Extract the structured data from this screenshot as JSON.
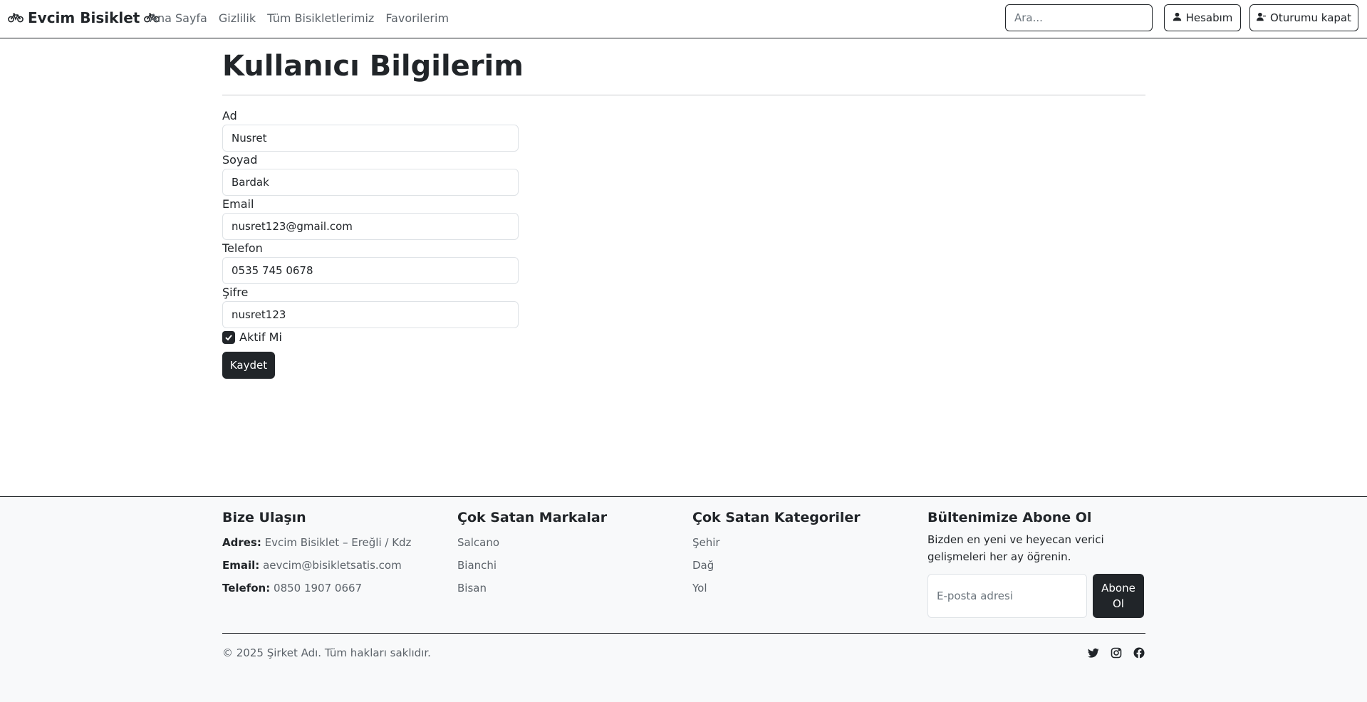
{
  "navbar": {
    "brand": "Evcim Bisiklet",
    "links": [
      "Ana Sayfa",
      "Gizlilik",
      "Tüm Bisikletlerimiz",
      "Favorilerim"
    ],
    "search_placeholder": "Ara...",
    "account_label": "Hesabım",
    "logout_label": "Oturumu kapat"
  },
  "main": {
    "title": "Kullanıcı Bilgilerim",
    "fields": [
      {
        "label": "Ad",
        "value": "Nusret"
      },
      {
        "label": "Soyad",
        "value": "Bardak"
      },
      {
        "label": "Email",
        "value": "nusret123@gmail.com"
      },
      {
        "label": "Telefon",
        "value": "0535 745 0678"
      },
      {
        "label": "Şifre",
        "value": "nusret123"
      }
    ],
    "active_label": "Aktif Mi",
    "active_checked": true,
    "save_label": "Kaydet"
  },
  "footer": {
    "contact": {
      "title": "Bize Ulaşın",
      "address_label": "Adres:",
      "address": "Evcim Bisiklet – Ereğli / Kdz",
      "email_label": "Email:",
      "email": "aevcim@bisikletsatis.com",
      "phone_label": "Telefon:",
      "phone": "0850 1907 0667"
    },
    "brands": {
      "title": "Çok Satan Markalar",
      "items": [
        "Salcano",
        "Bianchi",
        "Bisan"
      ]
    },
    "categories": {
      "title": "Çok Satan Kategoriler",
      "items": [
        "Şehir",
        "Dağ",
        "Yol"
      ]
    },
    "newsletter": {
      "title": "Bültenimize Abone Ol",
      "text": "Bizden en yeni ve heyecan verici gelişmeleri her ay öğrenin.",
      "placeholder": "E-posta adresi",
      "button_label": "Abone Ol"
    },
    "copyright": "© 2025 Şirket Adı. Tüm hakları saklıdır.",
    "socials": [
      "twitter-icon",
      "instagram-icon",
      "facebook-icon"
    ]
  }
}
